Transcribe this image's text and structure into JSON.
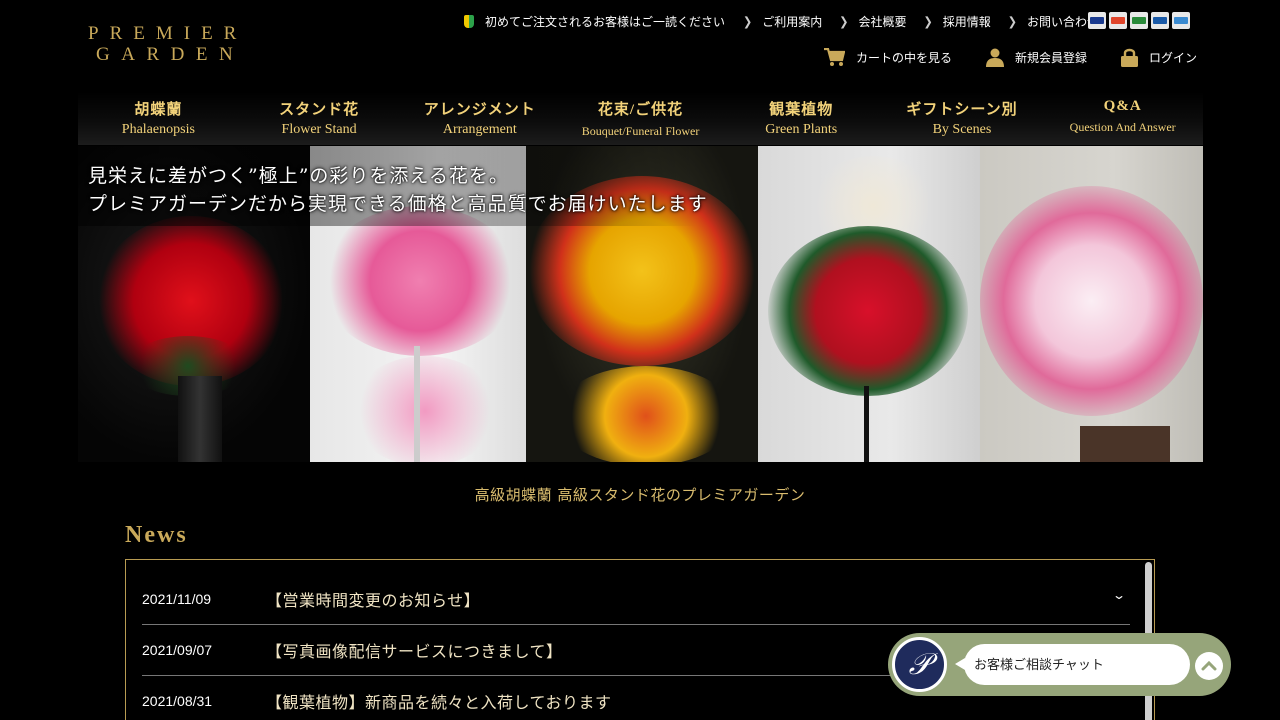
{
  "logo": {
    "line1": "PREMIER",
    "line2": "GARDEN"
  },
  "toplinks": {
    "beginner": "初めてご注文されるお客様はご一読ください",
    "items": [
      "ご利用案内",
      "会社概要",
      "採用情報",
      "お問い合わせ"
    ]
  },
  "payment_cards": [
    {
      "name": "visa",
      "color": "#1a3a8f"
    },
    {
      "name": "mastercard",
      "color": "#e0452b"
    },
    {
      "name": "jcb",
      "color": "#2a8a3a"
    },
    {
      "name": "diners",
      "color": "#1a5aa8"
    },
    {
      "name": "amex",
      "color": "#3a8ad0"
    }
  ],
  "subnav": {
    "cart": "カートの中を見る",
    "register": "新規会員登録",
    "login": "ログイン"
  },
  "mainnav": [
    {
      "jp": "胡蝶蘭",
      "en": "Phalaenopsis"
    },
    {
      "jp": "スタンド花",
      "en": "Flower Stand"
    },
    {
      "jp": "アレンジメント",
      "en": "Arrangement"
    },
    {
      "jp": "花束/ご供花",
      "en": "Bouquet/Funeral Flower"
    },
    {
      "jp": "観葉植物",
      "en": "Green Plants"
    },
    {
      "jp": "ギフトシーン別",
      "en": "By Scenes"
    },
    {
      "jp": "Q&A",
      "en": "Question And Answer"
    }
  ],
  "hero": {
    "line1": "見栄えに差がつく”極上”の彩りを添える花を。",
    "line2": "プレミアガーデンだから実現できる価格と高品質でお届けいたします"
  },
  "tagline": "高級胡蝶蘭 高級スタンド花のプレミアガーデン",
  "news": {
    "title": "News",
    "items": [
      {
        "date": "2021/11/09",
        "headline": "【営業時間変更のお知らせ】"
      },
      {
        "date": "2021/09/07",
        "headline": "【写真画像配信サービスにつきまして】"
      },
      {
        "date": "2021/08/31",
        "headline": "【観葉植物】新商品を続々と入荷しております"
      }
    ]
  },
  "chat": {
    "label": "お客様ご相談チャット"
  }
}
